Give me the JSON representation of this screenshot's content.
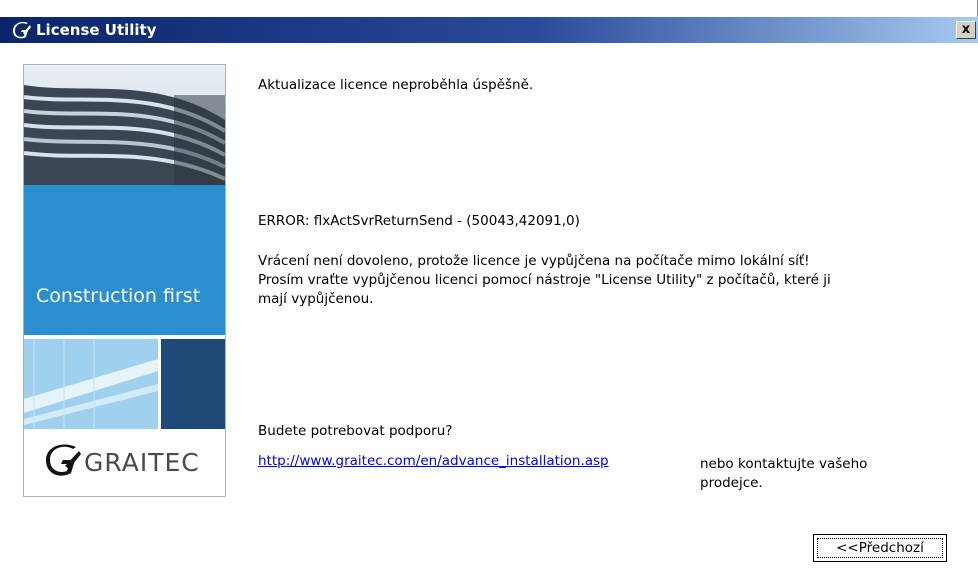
{
  "window": {
    "title": "License Utility",
    "close_label": "x"
  },
  "banner": {
    "tagline": "Construction first",
    "logo_text": "GRAITEC"
  },
  "content": {
    "success_message": "Aktualizace licence neproběhla úspěšně.",
    "error_message": "ERROR: flxActSvrReturnSend - (50043,42091,0)",
    "detail_line1": "Vrácení není dovoleno, protože licence je vypůjčena na počítače mimo lokální síť!",
    "detail_line2": "Prosím vraťte vypůjčenou licenci pomocí nástroje \"License Utility\" z počítačů, které ji",
    "detail_line3": "mají vypůjčenou.",
    "support_question": "Budete potrebovat podporu?",
    "support_link": "http://www.graitec.com/en/advance_installation.asp",
    "contact_line1": "nebo kontaktujte vašeho",
    "contact_line2": "prodejce."
  },
  "buttons": {
    "back_label": "<<Předchozí"
  },
  "colors": {
    "titlebar_start": "#0a246a",
    "titlebar_end": "#a6caf0",
    "banner_blue": "#2b8fcf",
    "link": "#0000ee"
  },
  "icons": {
    "title_icon": "graitec-g-icon",
    "logo_icon": "graitec-g-icon"
  }
}
